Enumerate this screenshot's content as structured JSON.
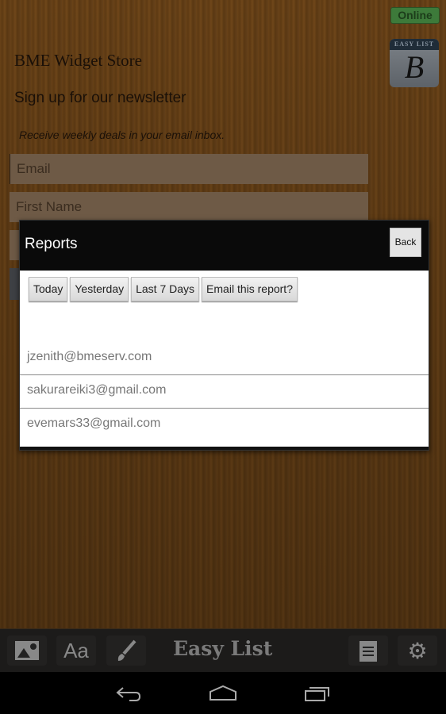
{
  "status": {
    "label": "Online",
    "color": "#3d7a3a"
  },
  "logo": {
    "band": "EASY LIST",
    "glyph": "B"
  },
  "page": {
    "store_title": "BME Widget Store",
    "subtitle": "Sign up for our newsletter",
    "description": "Receive weekly deals in your email inbox.",
    "fields": [
      {
        "placeholder": "Email"
      },
      {
        "placeholder": "First Name"
      }
    ]
  },
  "dialog": {
    "title": "Reports",
    "back_label": "Back",
    "filters": [
      {
        "label": "Today"
      },
      {
        "label": "Yesterday"
      },
      {
        "label": "Last 7 Days"
      },
      {
        "label": "Email this report?"
      }
    ],
    "emails": [
      "jzenith@bmeserv.com",
      "sakurareiki3@gmail.com",
      "evemars33@gmail.com"
    ]
  },
  "toolbar": {
    "title": "Easy List",
    "icons": [
      "image-icon",
      "font-icon",
      "brush-icon",
      "notepad-icon",
      "gear-icon"
    ]
  },
  "navbar": {
    "icons": [
      "back-icon",
      "home-icon",
      "recent-apps-icon"
    ]
  }
}
